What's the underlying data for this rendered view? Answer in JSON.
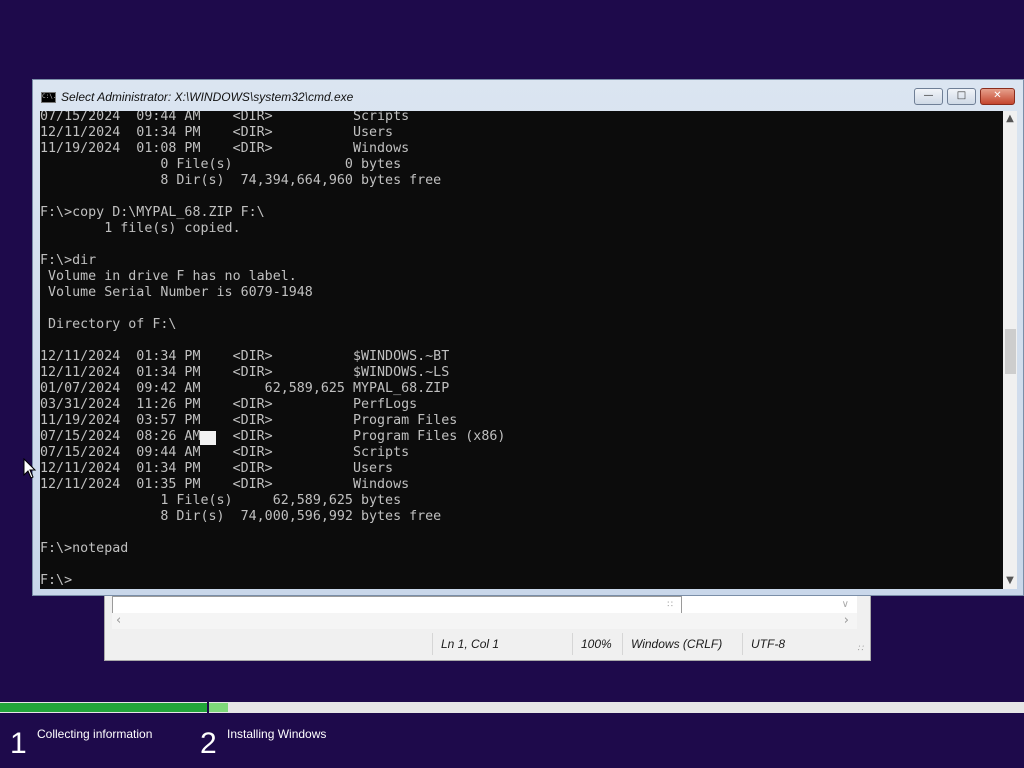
{
  "notepad": {
    "status": {
      "position": "Ln 1, Col 1",
      "zoom": "100%",
      "line_ending": "Windows (CRLF)",
      "encoding": "UTF-8"
    }
  },
  "cmd": {
    "title": "Select Administrator: X:\\WINDOWS\\system32\\cmd.exe",
    "icon_text": "C:\\.",
    "buttons": {
      "minimize": "—",
      "maximize": "□",
      "close": "✕"
    },
    "console_lines": [
      "07/15/2024  09:44 AM    <DIR>          Scripts",
      "12/11/2024  01:34 PM    <DIR>          Users",
      "11/19/2024  01:08 PM    <DIR>          Windows",
      "               0 File(s)              0 bytes",
      "               8 Dir(s)  74,394,664,960 bytes free",
      "",
      "F:\\>copy D:\\MYPAL_68.ZIP F:\\",
      "        1 file(s) copied.",
      "",
      "F:\\>dir",
      " Volume in drive F has no label.",
      " Volume Serial Number is 6079-1948",
      "",
      " Directory of F:\\",
      "",
      "12/11/2024  01:34 PM    <DIR>          $WINDOWS.~BT",
      "12/11/2024  01:34 PM    <DIR>          $WINDOWS.~LS",
      "01/07/2024  09:42 AM        62,589,625 MYPAL_68.ZIP",
      "03/31/2024  11:26 PM    <DIR>          PerfLogs",
      "11/19/2024  03:57 PM    <DIR>          Program Files",
      "07/15/2024  08:26 AM    <DIR>          Program Files (x86)",
      "07/15/2024  09:44 AM    <DIR>          Scripts",
      "12/11/2024  01:34 PM    <DIR>          Users",
      "12/11/2024  01:35 PM    <DIR>          Windows",
      "               1 File(s)     62,589,625 bytes",
      "               8 Dir(s)  74,000,596,992 bytes free",
      "",
      "F:\\>notepad",
      "",
      "F:\\>"
    ]
  },
  "setup": {
    "steps": [
      {
        "number": "1",
        "label": "Collecting information"
      },
      {
        "number": "2",
        "label": "Installing Windows"
      }
    ]
  },
  "colors": {
    "desktop": "#1e0a4b",
    "console_bg": "#0c0c0c",
    "console_text": "#c0c0c0",
    "progress_done": "#22a63a",
    "progress_active": "#7ed87a"
  }
}
